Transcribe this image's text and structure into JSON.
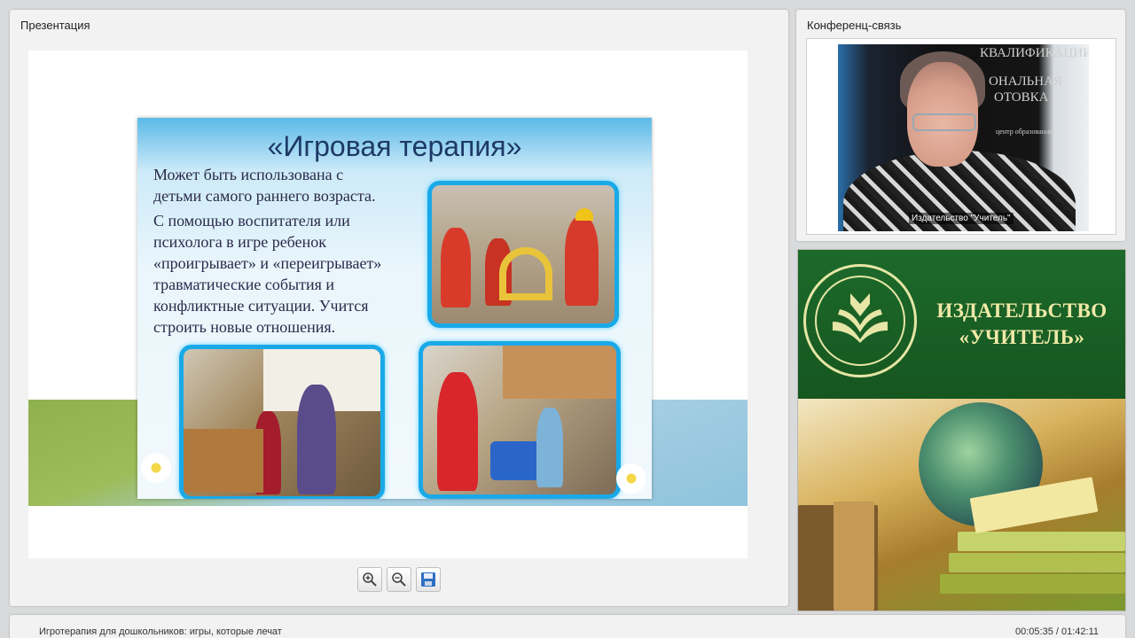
{
  "presentation": {
    "title": "Презентация",
    "slide": {
      "title": "«Игровая терапия»",
      "paragraph_1": "Может быть использована с детьми самого раннего возраста.",
      "paragraph_2": "С помощью воспитателя или психолога в игре ребенок «проигрывает» и «переигрывает» травматические события и конфликтные ситуации. Учится строить новые отношения."
    },
    "toolbar": {
      "zoom_in_icon": "zoom-in-icon",
      "zoom_out_icon": "zoom-out-icon",
      "save_icon": "save-icon"
    }
  },
  "conference": {
    "title": "Конференц-связь",
    "speaker_label": "Издательство \"Учитель\"",
    "wall_text": [
      "КВАЛИФИКАЦИИ",
      "ОНАЛЬНАЯ",
      "ОТОВКА",
      "центр образования"
    ]
  },
  "banner": {
    "line_1": "ИЗДАТЕЛЬСТВО",
    "line_2": "«УЧИТЕЛЬ»"
  },
  "status": {
    "lecture_title": "Игротерапия для дошкольников: игры, которые лечат",
    "time": "00:05:35 / 01:42:11"
  },
  "colors": {
    "accent_blue": "#1aa9e8",
    "publisher_green": "#1d6a2b",
    "publisher_gold": "#f0e9a8"
  }
}
